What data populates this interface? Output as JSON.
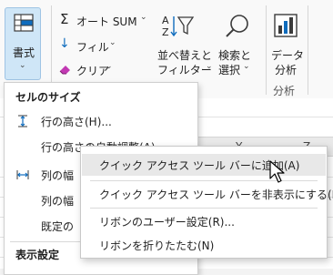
{
  "ribbon": {
    "format_label": "書式",
    "autosum_label": "オート SUM",
    "fill_label": "フィル",
    "clear_label": "クリア",
    "sort_filter_line1": "並べ替えと",
    "sort_filter_line2": "フィルター",
    "find_select_line1": "検索と",
    "find_select_line2": "選択",
    "analyze_line1": "データ",
    "analyze_line2": "分析",
    "analysis_group_label": "分析",
    "accent_color": "#0f6cbd"
  },
  "grid": {
    "col_header_1": "Y",
    "col_header_2": "Z"
  },
  "format_menu": {
    "cell_size_heading": "セルのサイズ",
    "items": [
      {
        "label": "行の高さ(H)..."
      },
      {
        "label": "行の高さの自動調整(A)"
      },
      {
        "label": "列の幅"
      },
      {
        "label": "列の幅"
      },
      {
        "label": "既定の"
      }
    ],
    "visibility_heading": "表示設定"
  },
  "context_menu": {
    "items": [
      {
        "label": "クイック アクセス ツール バーに追加(A)"
      },
      {
        "label": "クイック アクセス ツール バーを非表示にする(H)"
      },
      {
        "label": "リボンのユーザー設定(R)..."
      },
      {
        "label": "リボンを折りたたむ(N)"
      }
    ]
  }
}
